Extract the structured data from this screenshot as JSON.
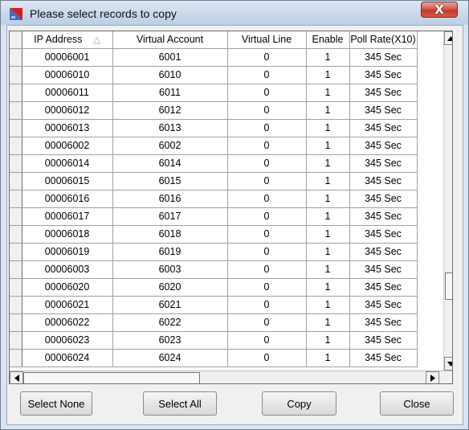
{
  "window": {
    "title": "Please select records to copy",
    "close_label": "X"
  },
  "grid": {
    "columns": [
      "IP Address",
      "Virtual Account",
      "Virtual Line",
      "Enable",
      "Poll Rate(X10)"
    ],
    "sort_indicator": "△",
    "rows": [
      [
        "00006001",
        "6001",
        "0",
        "1",
        "345 Sec"
      ],
      [
        "00006010",
        "6010",
        "0",
        "1",
        "345 Sec"
      ],
      [
        "00006011",
        "6011",
        "0",
        "1",
        "345 Sec"
      ],
      [
        "00006012",
        "6012",
        "0",
        "1",
        "345 Sec"
      ],
      [
        "00006013",
        "6013",
        "0",
        "1",
        "345 Sec"
      ],
      [
        "00006002",
        "6002",
        "0",
        "1",
        "345 Sec"
      ],
      [
        "00006014",
        "6014",
        "0",
        "1",
        "345 Sec"
      ],
      [
        "00006015",
        "6015",
        "0",
        "1",
        "345 Sec"
      ],
      [
        "00006016",
        "6016",
        "0",
        "1",
        "345 Sec"
      ],
      [
        "00006017",
        "6017",
        "0",
        "1",
        "345 Sec"
      ],
      [
        "00006018",
        "6018",
        "0",
        "1",
        "345 Sec"
      ],
      [
        "00006019",
        "6019",
        "0",
        "1",
        "345 Sec"
      ],
      [
        "00006003",
        "6003",
        "0",
        "1",
        "345 Sec"
      ],
      [
        "00006020",
        "6020",
        "0",
        "1",
        "345 Sec"
      ],
      [
        "00006021",
        "6021",
        "0",
        "1",
        "345 Sec"
      ],
      [
        "00006022",
        "6022",
        "0",
        "1",
        "345 Sec"
      ],
      [
        "00006023",
        "6023",
        "0",
        "1",
        "345 Sec"
      ],
      [
        "00006024",
        "6024",
        "0",
        "1",
        "345 Sec"
      ]
    ]
  },
  "buttons": {
    "select_none": "Select None",
    "select_all": "Select All",
    "copy": "Copy",
    "close": "Close"
  },
  "icons": {
    "app": "app-icon",
    "scroll_up": "scroll-up-arrow-icon",
    "scroll_down": "scroll-down-arrow-icon",
    "scroll_left": "scroll-left-arrow-icon",
    "scroll_right": "scroll-right-arrow-icon"
  },
  "colors": {
    "window_frame": "#d9e4f1",
    "close_button": "#c23a2b",
    "grid_lines": "#a0a0a0"
  }
}
